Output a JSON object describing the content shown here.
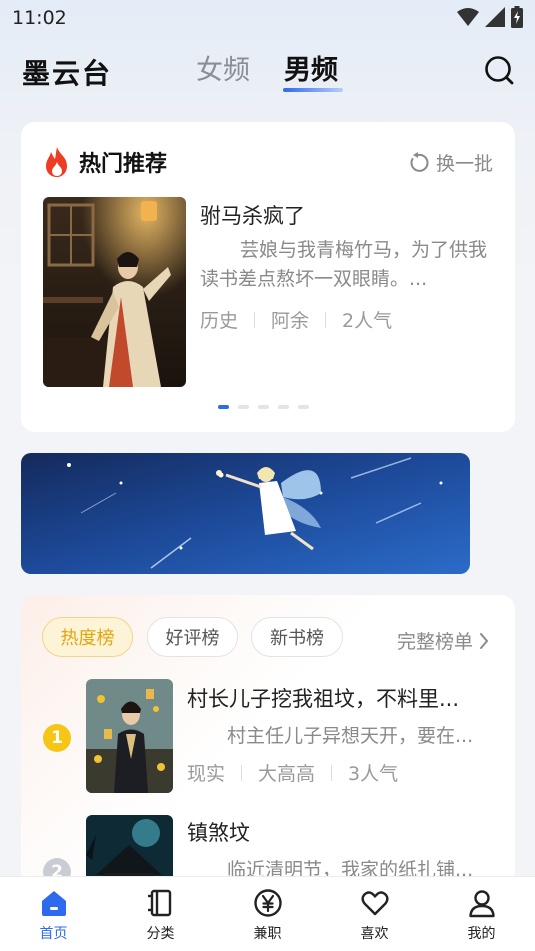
{
  "status_bar": {
    "time": "11:02"
  },
  "header": {
    "app_title": "墨云台",
    "tabs": [
      {
        "label": "女频",
        "active": false
      },
      {
        "label": "男频",
        "active": true
      }
    ]
  },
  "hot_section": {
    "title": "热门推荐",
    "refresh_label": "换一批",
    "book": {
      "title": "驸马杀疯了",
      "description": "芸娘与我青梅竹马，为了供我读书差点熬坏一双眼睛。...",
      "genre": "历史",
      "author": "阿余",
      "popularity": "2人气"
    },
    "carousel_pages": 5,
    "carousel_active_index": 0
  },
  "rank_section": {
    "tabs": [
      {
        "label": "热度榜",
        "active": true
      },
      {
        "label": "好评榜",
        "active": false
      },
      {
        "label": "新书榜",
        "active": false
      }
    ],
    "full_list_label": "完整榜单",
    "books": [
      {
        "rank": "1",
        "title": "村长儿子挖我祖坟，不料里...",
        "description": "村主任儿子异想天开，要在...",
        "genre": "现实",
        "author": "大高高",
        "popularity": "3人气"
      },
      {
        "rank": "2",
        "title": "镇煞坟",
        "description": "临近清明节，我家的纸扎铺..."
      }
    ]
  },
  "bottom_nav": [
    {
      "label": "首页",
      "icon": "home-icon",
      "active": true
    },
    {
      "label": "分类",
      "icon": "category-icon",
      "active": false
    },
    {
      "label": "兼职",
      "icon": "yuan-icon",
      "active": false
    },
    {
      "label": "喜欢",
      "icon": "heart-icon",
      "active": false
    },
    {
      "label": "我的",
      "icon": "user-icon",
      "active": false
    }
  ],
  "colors": {
    "accent": "#2e6af0",
    "hot_rank": "#f7c514",
    "hot_chip_text": "#e2a60d",
    "fire": "#ee3b24"
  }
}
